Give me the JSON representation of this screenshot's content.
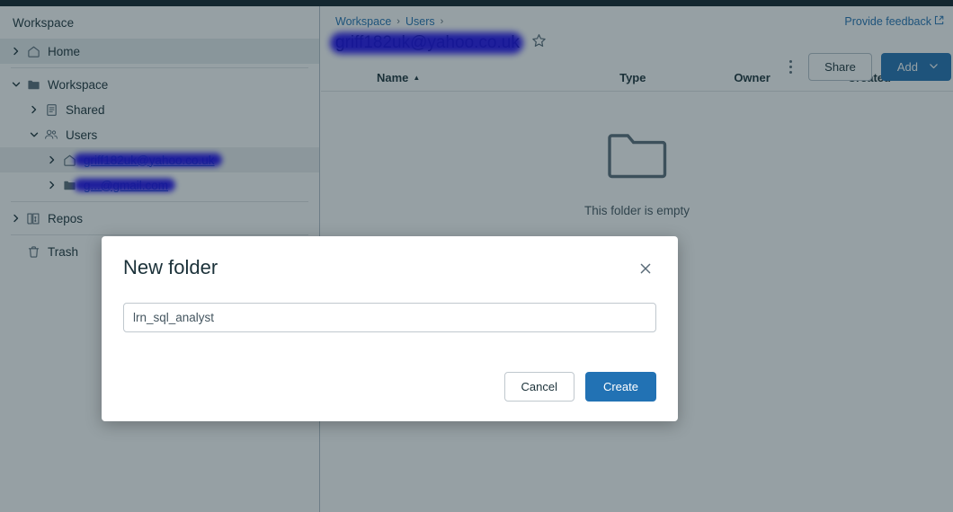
{
  "sidebar": {
    "title": "Workspace",
    "items": [
      {
        "label": "Home",
        "icon": "home-icon",
        "chevron": "chevron-right",
        "state": "selected",
        "indent": 1
      },
      {
        "label": "Workspace",
        "icon": "folder-filled-icon",
        "chevron": "chevron-down",
        "state": "normal",
        "indent": 1
      },
      {
        "label": "Shared",
        "icon": "document-icon",
        "chevron": "chevron-right",
        "state": "normal",
        "indent": 2
      },
      {
        "label": "Users",
        "icon": "people-icon",
        "chevron": "chevron-down",
        "state": "normal",
        "indent": 2
      },
      {
        "label": "griff182uk@yahoo.co.uk",
        "icon": "home-icon",
        "chevron": "chevron-right",
        "state": "highlight",
        "indent": 3,
        "redacted": true
      },
      {
        "label": "g...@gmail.com",
        "icon": "folder-filled-icon",
        "chevron": "chevron-right",
        "state": "normal",
        "indent": 3,
        "redacted": true
      },
      {
        "label": "Repos",
        "icon": "repo-icon",
        "chevron": "chevron-right",
        "state": "normal",
        "indent": 1
      },
      {
        "label": "Trash",
        "icon": "trash-icon",
        "chevron": "none",
        "state": "normal",
        "indent": 1
      }
    ]
  },
  "main": {
    "breadcrumb": [
      {
        "label": "Workspace"
      },
      {
        "label": "Users"
      }
    ],
    "breadcrumb_separator": "›",
    "feedback_label": "Provide feedback",
    "feedback_icon": "external-link-icon",
    "page_title": "griff182uk@yahoo.co.uk",
    "star_icon": "star-outline-icon",
    "kebab_icon": "more-vertical-icon",
    "share_label": "Share",
    "add_label": "Add",
    "add_caret_icon": "chevron-down-icon",
    "table": {
      "columns": [
        "Name",
        "Type",
        "Owner",
        "Created"
      ],
      "sort_column": "Name",
      "sort_direction": "asc",
      "sort_indicator": "▲",
      "rows": []
    },
    "empty_state": {
      "icon": "folder-outline-icon",
      "text": "This folder is empty"
    }
  },
  "modal": {
    "title": "New folder",
    "close_icon": "close-icon",
    "input": {
      "value": "lrn_sql_analyst",
      "placeholder": "lrn_sql_analyst"
    },
    "cancel_label": "Cancel",
    "create_label": "Create"
  },
  "colors": {
    "accent": "#2272b4",
    "text": "#1b3139",
    "muted": "#5a6b78",
    "topbar": "#10212a",
    "redaction": "#1400f0",
    "scrim": "rgba(27,49,57,0.46)"
  }
}
